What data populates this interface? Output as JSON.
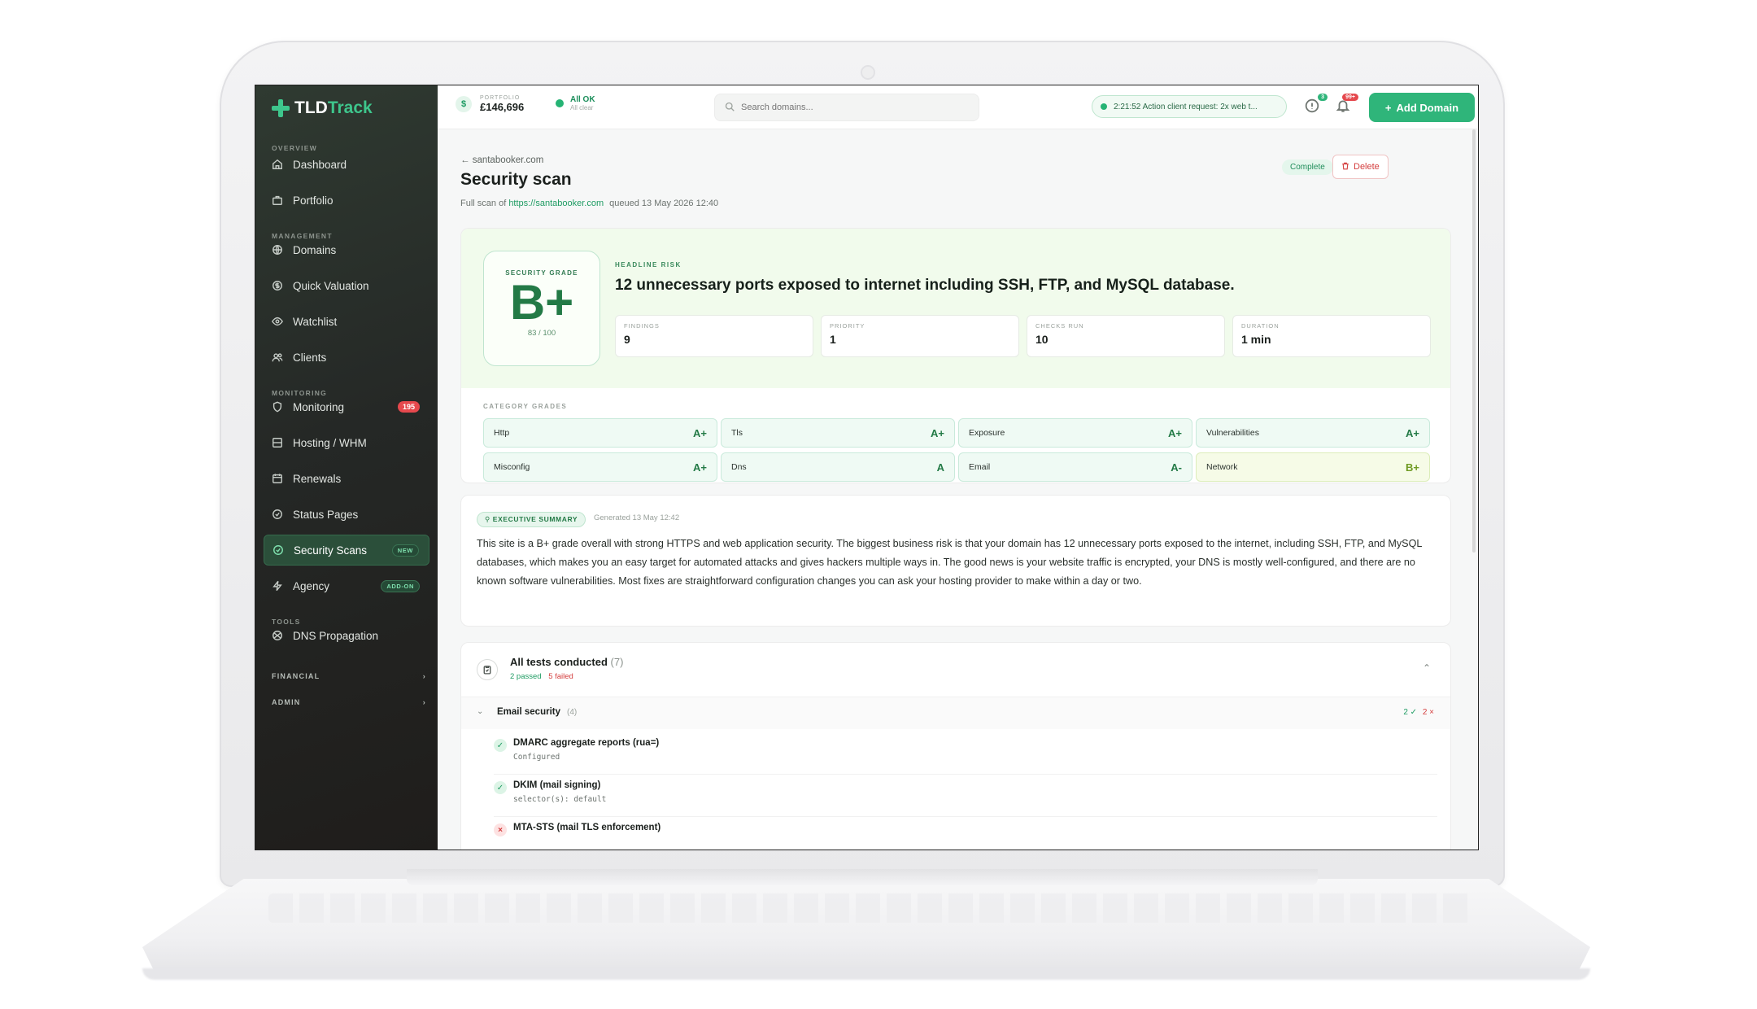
{
  "sidebar": {
    "logo": {
      "tld": "TLD",
      "track": "Track"
    },
    "sections": {
      "overview": "OVERVIEW",
      "management": "MANAGEMENT",
      "monitoring": "MONITORING",
      "tools": "TOOLS"
    },
    "items": [
      {
        "label": "Dashboard",
        "icon": "home-icon"
      },
      {
        "label": "Portfolio",
        "icon": "briefcase-icon"
      },
      {
        "label": "Domains",
        "icon": "globe-icon"
      },
      {
        "label": "Quick Valuation",
        "icon": "dollar-icon"
      },
      {
        "label": "Watchlist",
        "icon": "eye-icon"
      },
      {
        "label": "Clients",
        "icon": "users-icon"
      },
      {
        "label": "Monitoring",
        "icon": "shield-icon",
        "badge": "195"
      },
      {
        "label": "Hosting / WHM",
        "icon": "server-icon"
      },
      {
        "label": "Renewals",
        "icon": "calendar-icon"
      },
      {
        "label": "Status Pages",
        "icon": "check-circle-icon"
      },
      {
        "label": "Security Scans",
        "icon": "shield-check-icon",
        "badge": "NEW",
        "active": true
      },
      {
        "label": "Agency",
        "icon": "bolt-icon",
        "badge": "ADD-ON"
      },
      {
        "label": "DNS Propagation",
        "icon": "network-icon"
      }
    ],
    "groups": [
      "FINANCIAL",
      "ADMIN"
    ]
  },
  "topbar": {
    "portfolio_label": "PORTFOLIO",
    "portfolio_value": "£146,696",
    "status_title": "All OK",
    "status_sub": "All clear",
    "search_placeholder": "Search domains...",
    "job_text": "2:21:52  Action client request: 2x web t...",
    "help_badge": "3",
    "notif_badge": "99+",
    "add_button": "Add Domain"
  },
  "page": {
    "breadcrumb": "← santabooker.com",
    "title": "Security scan",
    "subtitle_prefix": "Full scan of",
    "subtitle_link": "https://santabooker.com",
    "subtitle_suffix": "queued 13 May 2026 12:40",
    "status": "Complete",
    "delete_label": "Delete"
  },
  "grade": {
    "label": "SECURITY GRADE",
    "grade": "B+",
    "score": "83 / 100",
    "headline_label": "HEADLINE RISK",
    "headline": "12 unnecessary ports exposed to internet including SSH, FTP, and MySQL database.",
    "stats": [
      {
        "label": "FINDINGS",
        "value": "9"
      },
      {
        "label": "PRIORITY",
        "value": "1"
      },
      {
        "label": "CHECKS RUN",
        "value": "10"
      },
      {
        "label": "DURATION",
        "value": "1 min"
      }
    ],
    "category_label": "CATEGORY GRADES",
    "categories": [
      {
        "name": "Http",
        "grade": "A+"
      },
      {
        "name": "Tls",
        "grade": "A+"
      },
      {
        "name": "Exposure",
        "grade": "A+"
      },
      {
        "name": "Vulnerabilities",
        "grade": "A+"
      },
      {
        "name": "Misconfig",
        "grade": "A+"
      },
      {
        "name": "Dns",
        "grade": "A"
      },
      {
        "name": "Email",
        "grade": "A-"
      },
      {
        "name": "Network",
        "grade": "B+"
      }
    ]
  },
  "summary": {
    "pill": "EXECUTIVE SUMMARY",
    "generated": "Generated 13 May 12:42",
    "text": "This site is a B+ grade overall with strong HTTPS and web application security. The biggest business risk is that your domain has 12 unnecessary ports exposed to the internet, including SSH, FTP, and MySQL databases, which makes you an easy target for automated attacks and gives hackers multiple ways in. The good news is your website traffic is encrypted, your DNS is mostly well-configured, and there are no known software vulnerabilities. Most fixes are straightforward configuration changes you can ask your hosting provider to make within a day or two."
  },
  "tests": {
    "title": "All tests conducted",
    "count": "(7)",
    "passed": "2 passed",
    "failed": "5 failed",
    "group": {
      "name": "Email security",
      "count": "(4)",
      "passed": "2 ✓",
      "failed": "2 ×"
    },
    "rows": [
      {
        "name": "DMARC aggregate reports (rua=)",
        "detail": "Configured",
        "ok": true
      },
      {
        "name": "DKIM (mail signing)",
        "detail": "selector(s): default",
        "ok": true
      },
      {
        "name": "MTA-STS (mail TLS enforcement)",
        "detail": "",
        "ok": false
      }
    ]
  }
}
